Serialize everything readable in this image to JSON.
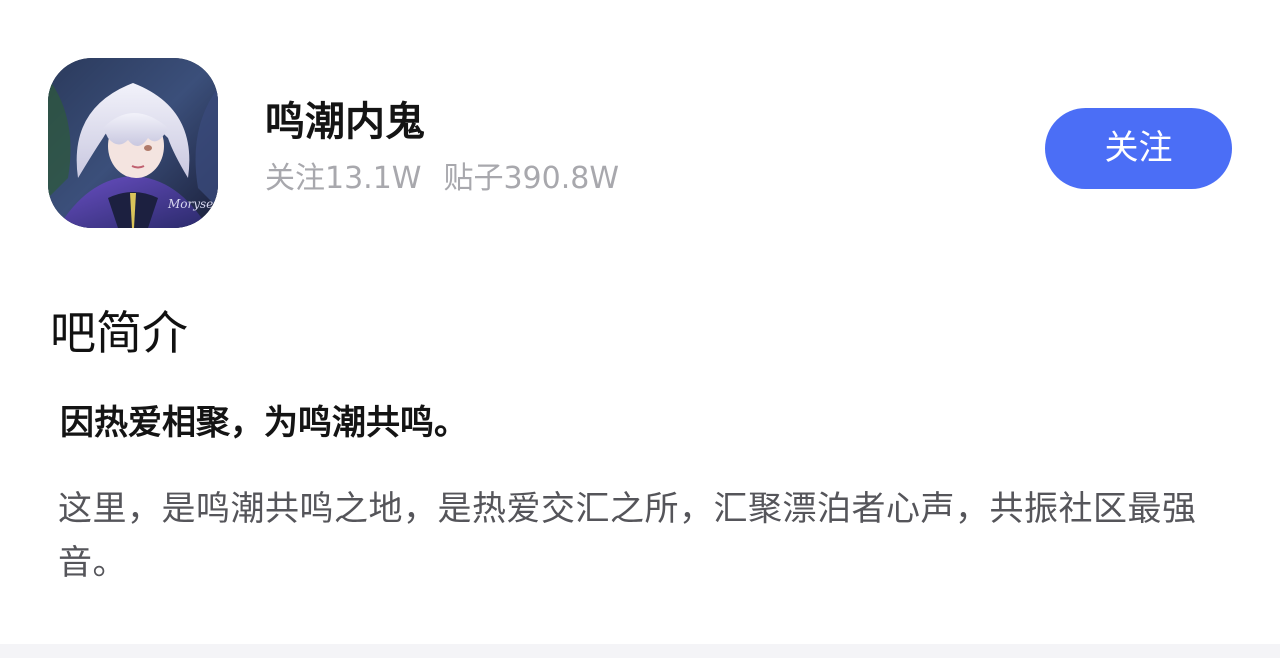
{
  "forum": {
    "name": "鸣潮内鬼",
    "stats": {
      "followers": "关注13.1W",
      "posts": "贴子390.8W"
    },
    "follow_button_label": "关注",
    "accent_color": "#4b6ef6"
  },
  "intro": {
    "title": "吧简介",
    "slogan": "因热爱相聚，为鸣潮共鸣。",
    "description": "这里，是鸣潮共鸣之地，是热爱交汇之所，汇聚漂泊者心声，共振社区最强音。"
  },
  "avatar": {
    "icon": "anime-character-avatar",
    "signature": "Moryse"
  }
}
